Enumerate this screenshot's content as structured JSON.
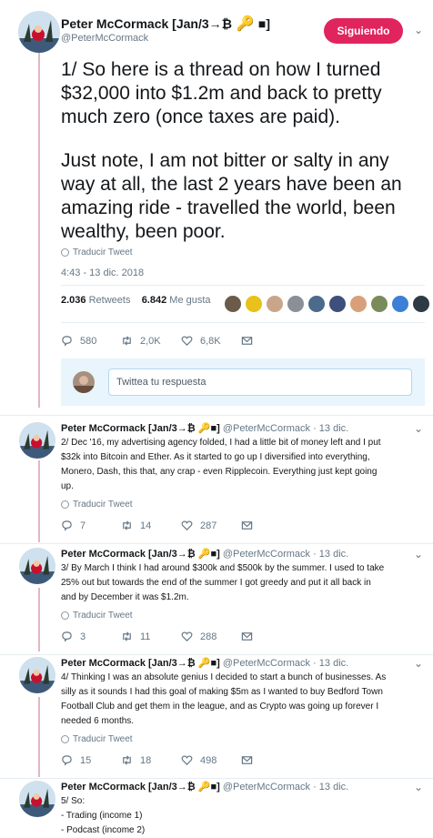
{
  "main_tweet": {
    "author_name": "Peter McCormack [Jan/3→₿",
    "author_name_tail": "■]",
    "author_handle": "@PeterMcCormack",
    "follow_label": "Siguiendo",
    "paragraph_1": "1/ So here is a thread on how I turned $32,000 into $1.2m and back to pretty much zero (once taxes are paid).",
    "paragraph_2": "Just note, I am not bitter or salty in any way at all, the last 2 years have been an amazing ride - travelled the world, been wealthy, been poor.",
    "translate_label": "Traducir Tweet",
    "timestamp": "4:43 - 13 dic. 2018",
    "retweets_count": "2.036",
    "retweets_label": "Retweets",
    "likes_count": "6.842",
    "likes_label": "Me gusta",
    "liker_colors": [
      "#6b5b4a",
      "#e8c21a",
      "#c9a58a",
      "#8a8f98",
      "#4a6b8a",
      "#3d4f7a",
      "#d8a07a",
      "#7a8a5b",
      "#3b7fd6",
      "#2f3b44"
    ],
    "reply_count": "580",
    "retweet_action_count": "2,0K",
    "like_action_count": "6,8K"
  },
  "reply_composer": {
    "placeholder": "Twittea tu respuesta"
  },
  "replies": [
    {
      "author_name": "Peter McCormack [Jan/3→₿",
      "author_name_tail": "■]",
      "author_handle": "@PeterMcCormack",
      "date": "· 13 dic.",
      "lines": [
        "2/ Dec '16, my advertising agency folded, I had a little bit of money left and I put",
        "$32k into Bitcoin and Ether. As it started to go up I diversified into everything,",
        "Monero, Dash, this that, any crap - even Ripplecoin. Everything just kept going",
        "up."
      ],
      "translate_label": "Traducir Tweet",
      "replies": "7",
      "retweets": "14",
      "likes": "287"
    },
    {
      "author_name": "Peter McCormack [Jan/3→₿",
      "author_name_tail": "■]",
      "author_handle": "@PeterMcCormack",
      "date": "· 13 dic.",
      "lines": [
        "3/ By March I think I had around $300k and $500k by the summer. I used to take",
        "25% out but towards the end of the summer I got greedy and put it all back in",
        "and by December it was $1.2m."
      ],
      "translate_label": "Traducir Tweet",
      "replies": "3",
      "retweets": "11",
      "likes": "288"
    },
    {
      "author_name": "Peter McCormack [Jan/3→₿",
      "author_name_tail": "■]",
      "author_handle": "@PeterMcCormack",
      "date": "· 13 dic.",
      "lines": [
        "4/ Thinking I was an absolute genius I decided to start a bunch of businesses. As",
        "silly as it sounds I had this goal of making $5m as I wanted to buy Bedford Town",
        "Football Club and get them in the league, and as Crypto was going up forever I",
        "needed 6 months."
      ],
      "translate_label": "Traducir Tweet",
      "replies": "15",
      "retweets": "18",
      "likes": "498"
    },
    {
      "author_name": "Peter McCormack [Jan/3→₿",
      "author_name_tail": "■]",
      "author_handle": "@PeterMcCormack",
      "date": "· 13 dic.",
      "lines": [
        "5/ So:",
        "- Trading (income 1)",
        "- Podcast (income 2)"
      ]
    }
  ],
  "colors": {
    "follow": "#e0245e",
    "thread_line": "#e3b6c2",
    "muted": "#657786"
  }
}
